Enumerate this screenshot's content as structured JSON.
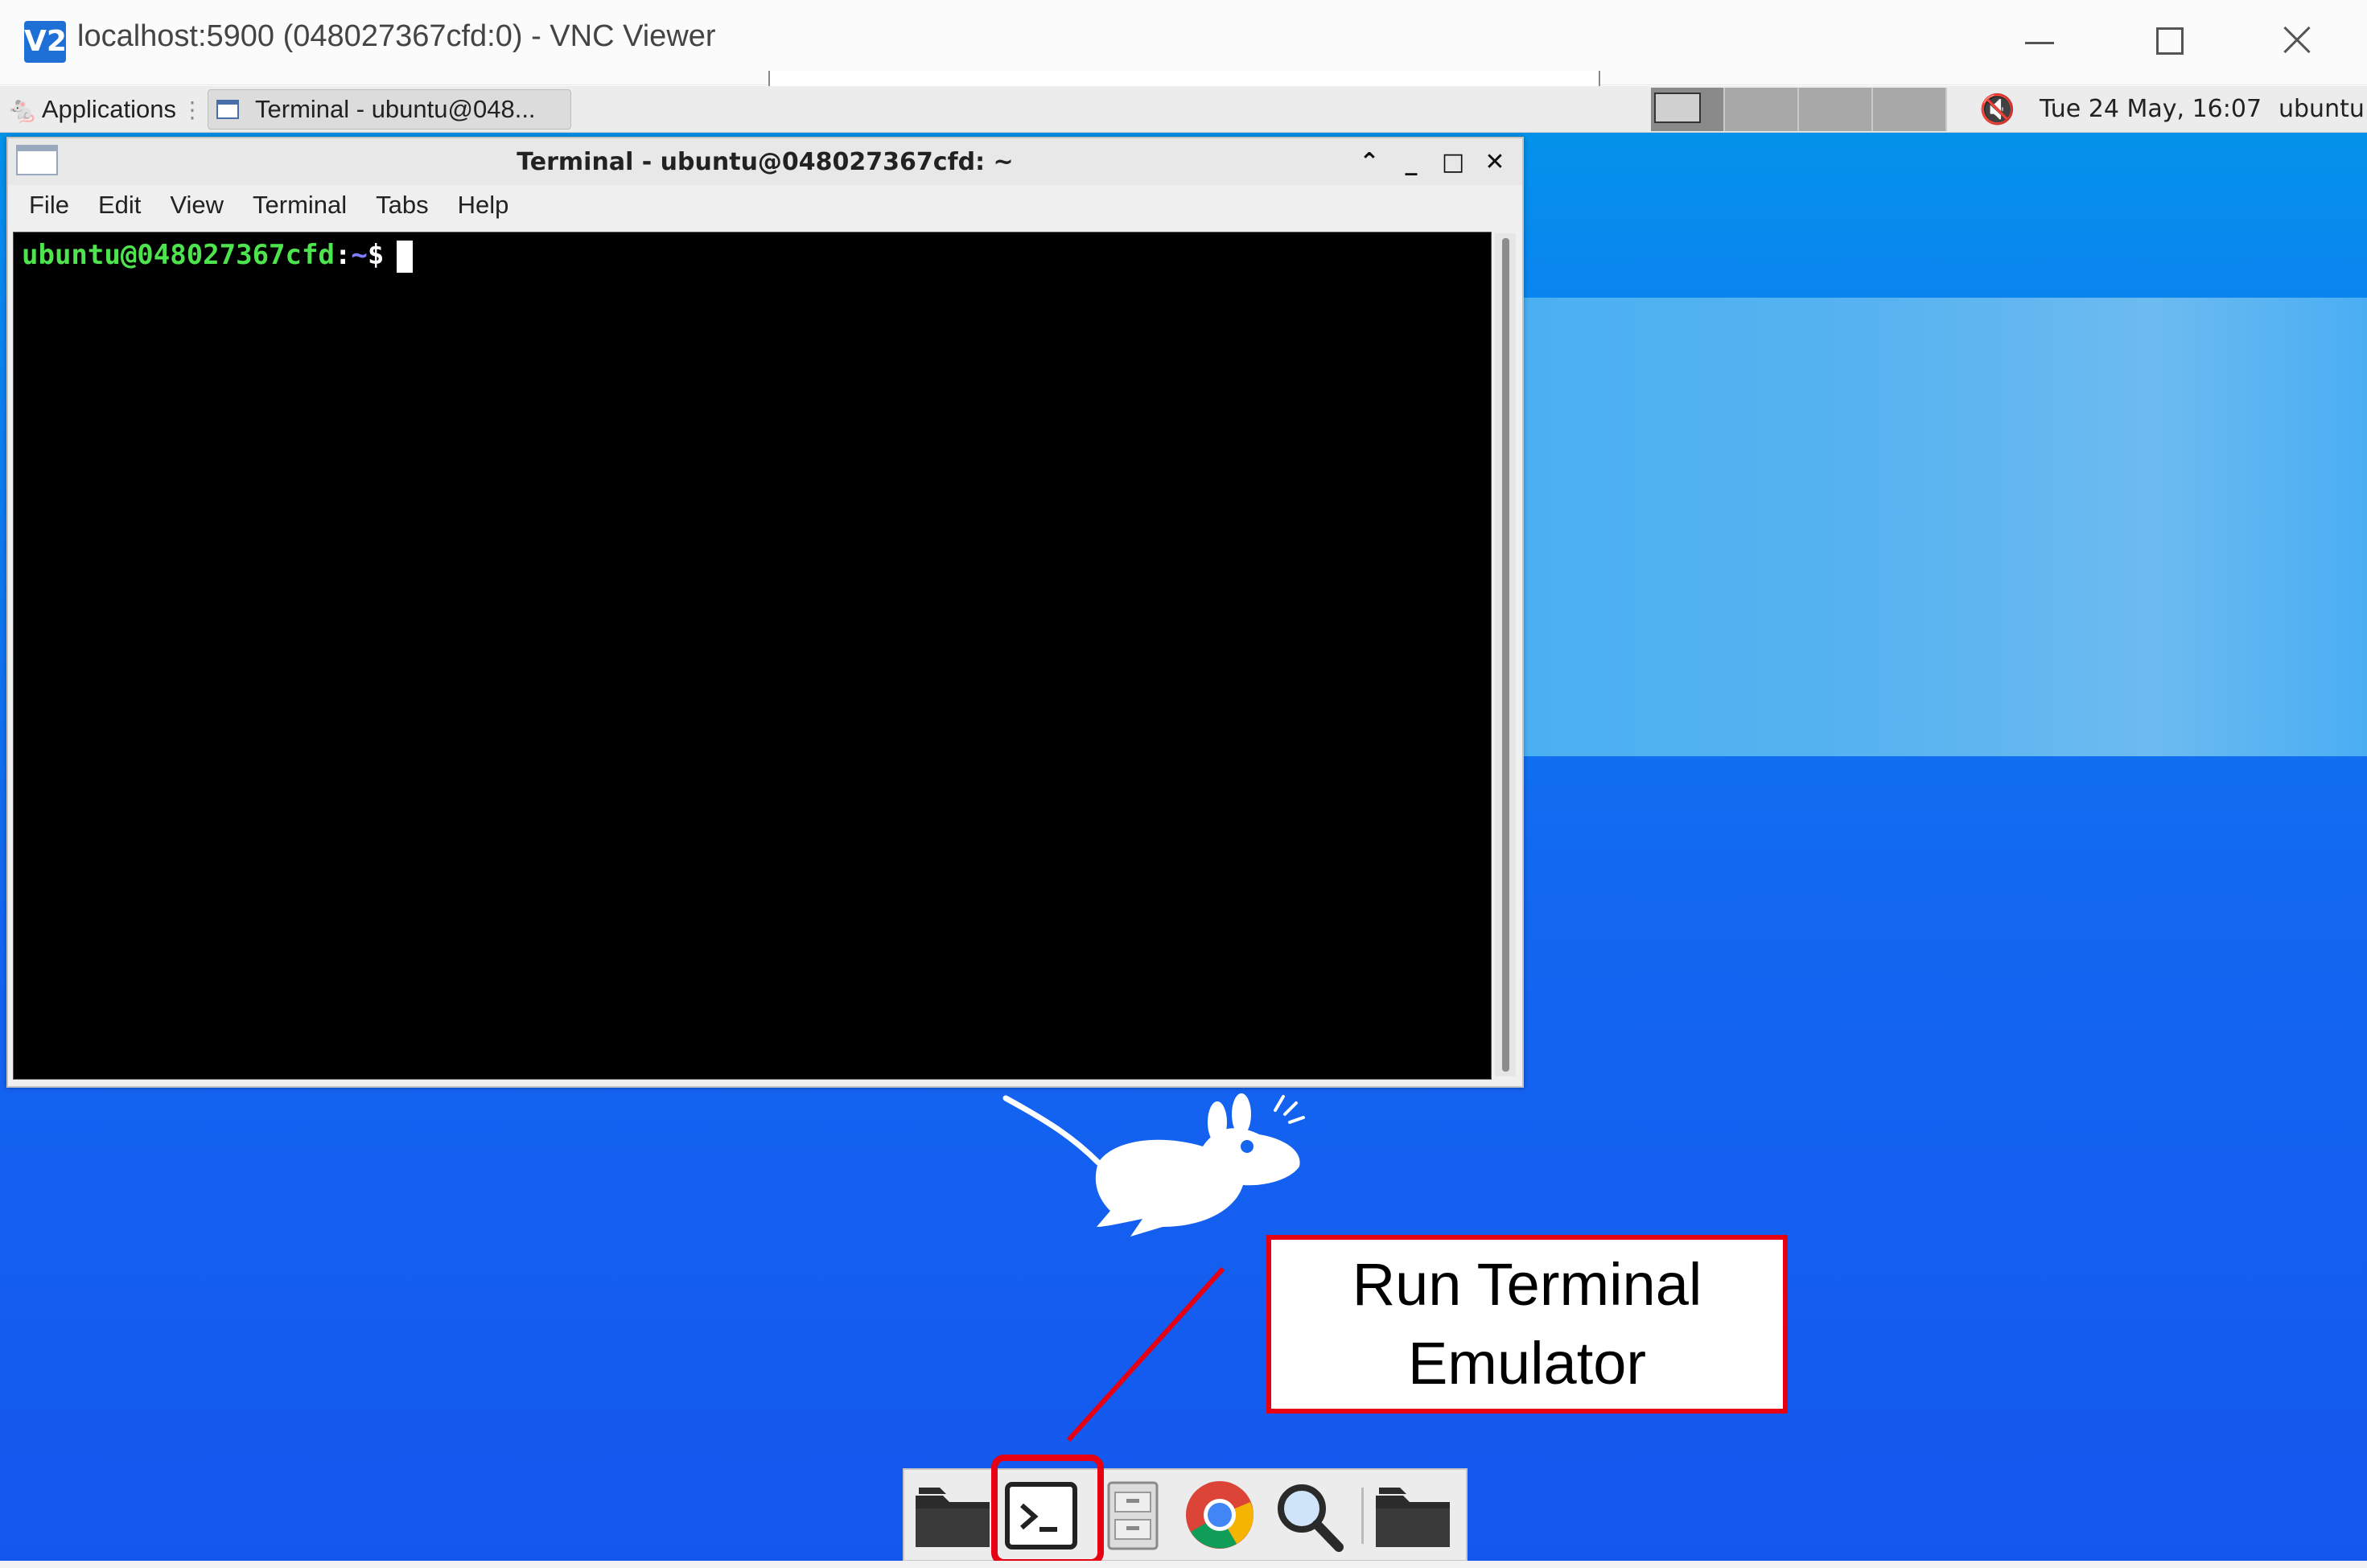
{
  "vnc": {
    "title": "localhost:5900 (048027367cfd:0) - VNC Viewer",
    "logo": "V2"
  },
  "panel": {
    "apps_label": "Applications",
    "taskbar_label": "Terminal - ubuntu@048...",
    "clock": "Tue 24 May, 16:07",
    "user": "ubuntu"
  },
  "terminal": {
    "title": "Terminal - ubuntu@048027367cfd: ~",
    "menu": [
      "File",
      "Edit",
      "View",
      "Terminal",
      "Tabs",
      "Help"
    ],
    "prompt_user": "ubuntu@048027367cfd",
    "prompt_colon": ":",
    "prompt_path": "~",
    "prompt_dollar": "$"
  },
  "annotation": {
    "text": "Run Terminal Emulator",
    "color": "#e60012"
  },
  "dock": {
    "items": [
      "folder-icon",
      "terminal-icon",
      "file-cabinet-icon",
      "chrome-icon",
      "magnifier-icon",
      "folder-icon"
    ]
  },
  "colors": {
    "prompt_user": "#4ee44e",
    "prompt_path": "#7f7fff",
    "desktop": "#1366f0"
  }
}
